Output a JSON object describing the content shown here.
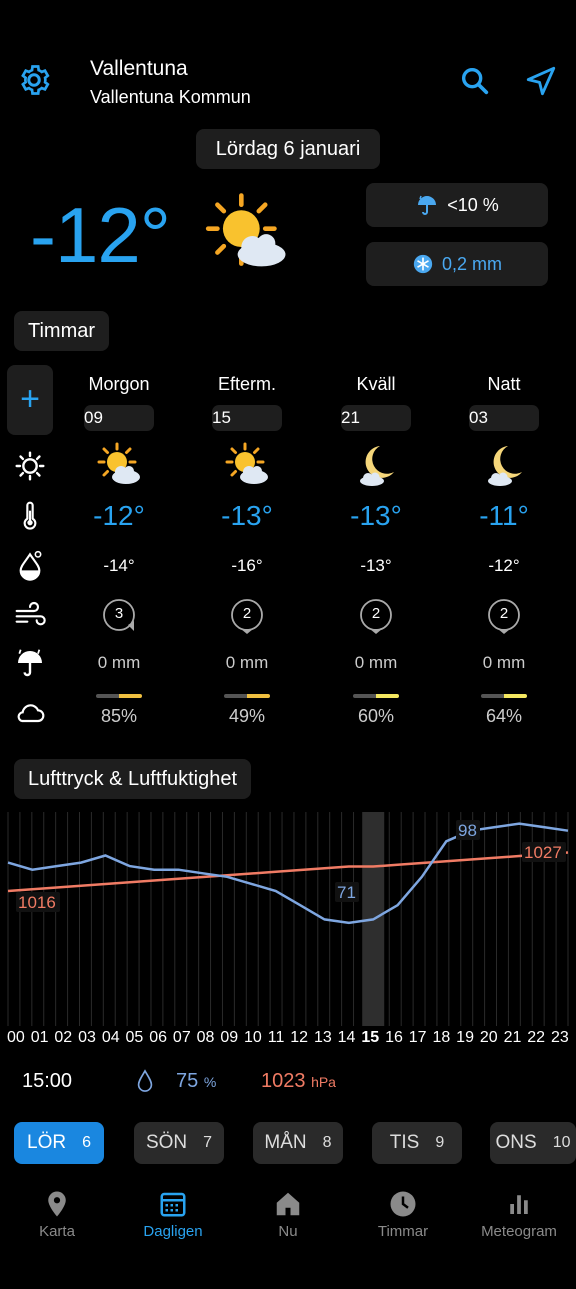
{
  "header": {
    "location": "Vallentuna",
    "sublocation": "Vallentuna Kommun",
    "date": "Lördag 6 januari"
  },
  "current": {
    "temp": "-12°",
    "precip_chance": "<10 %",
    "precip_amount": "0,2 mm"
  },
  "sections": {
    "hours": "Timmar",
    "pressure": "Lufttryck & Luftfuktighet"
  },
  "periods": [
    {
      "name": "Morgon",
      "hour": "09",
      "temp": "-12°",
      "feels": "-14°",
      "wind": "3",
      "rain": "0 mm",
      "cloud": "85%"
    },
    {
      "name": "Efterm.",
      "hour": "15",
      "temp": "-13°",
      "feels": "-16°",
      "wind": "2",
      "rain": "0 mm",
      "cloud": "49%"
    },
    {
      "name": "Kväll",
      "hour": "21",
      "temp": "-13°",
      "feels": "-13°",
      "wind": "2",
      "rain": "0 mm",
      "cloud": "60%"
    },
    {
      "name": "Natt",
      "hour": "03",
      "temp": "-11°",
      "feels": "-12°",
      "wind": "2",
      "rain": "0 mm",
      "cloud": "64%"
    }
  ],
  "chart_data": {
    "type": "line",
    "x": [
      "00",
      "01",
      "02",
      "03",
      "04",
      "05",
      "06",
      "07",
      "08",
      "09",
      "10",
      "11",
      "12",
      "13",
      "14",
      "15",
      "16",
      "17",
      "18",
      "19",
      "20",
      "21",
      "22",
      "23"
    ],
    "series": [
      {
        "name": "Luftfuktighet",
        "unit": "%",
        "color": "#7ea6e0",
        "values": [
          88,
          86,
          87,
          88,
          90,
          87,
          86,
          86,
          85,
          84,
          82,
          80,
          76,
          72,
          71,
          72,
          76,
          84,
          94,
          97,
          98,
          99,
          98,
          97
        ]
      },
      {
        "name": "Lufttryck",
        "unit": "hPa",
        "color": "#f07b64",
        "values": [
          1016,
          1016.5,
          1017,
          1017.5,
          1018,
          1018.5,
          1019,
          1019.5,
          1020,
          1020.5,
          1021,
          1021.5,
          1022,
          1022.5,
          1023,
          1023,
          1023.5,
          1024,
          1024.5,
          1025,
          1025.5,
          1026,
          1026.5,
          1027
        ]
      }
    ],
    "annotations": {
      "humidity_max": "98",
      "humidity_min": "71",
      "pressure_start": "1016",
      "pressure_end": "1027"
    },
    "selected_hour": "15"
  },
  "readout": {
    "time": "15:00",
    "humidity": "75",
    "humidity_unit": "%",
    "pressure": "1023",
    "pressure_unit": "hPa"
  },
  "days": [
    {
      "label": "LÖR",
      "num": "6",
      "active": true
    },
    {
      "label": "SÖN",
      "num": "7"
    },
    {
      "label": "MÅN",
      "num": "8"
    },
    {
      "label": "TIS",
      "num": "9"
    },
    {
      "label": "ONS",
      "num": "10"
    }
  ],
  "nav": [
    {
      "label": "Karta",
      "icon": "map-pin-icon"
    },
    {
      "label": "Dagligen",
      "icon": "calendar-icon",
      "active": true
    },
    {
      "label": "Nu",
      "icon": "home-icon"
    },
    {
      "label": "Timmar",
      "icon": "clock-icon"
    },
    {
      "label": "Meteogram",
      "icon": "bar-chart-icon"
    }
  ],
  "colors": {
    "accent": "#29a3f0",
    "humidity": "#7ea6e0",
    "pressure": "#f07b64"
  }
}
